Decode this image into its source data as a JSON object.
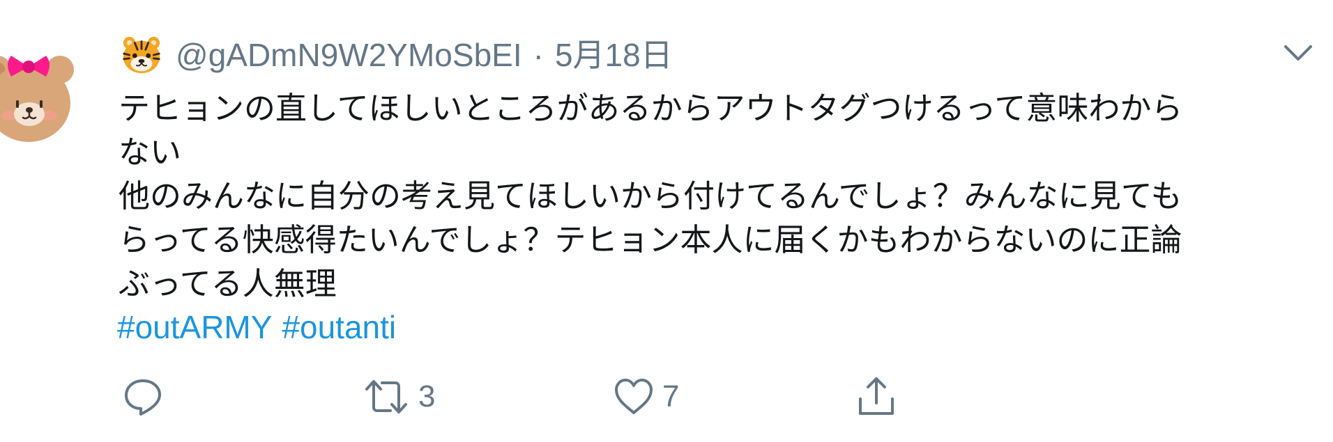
{
  "tweet": {
    "avatar_icon": "bear-with-pink-bow-avatar",
    "name_emoji_icon": "tiger-face-icon",
    "handle": "@gADmN9W2YMoSbEI",
    "separator": "·",
    "date": "5月18日",
    "menu_icon": "chevron-down-icon",
    "body_lines": [
      "テヒョンの直してほしいところがあるからアウトタグつけるって意味わから",
      "ない",
      "他のみんなに自分の考え見てほしいから付けてるんでしょ？みんなに見ても",
      "らってる快感得たいんでしょ？テヒョン本人に届くかもわからないのに正論",
      "ぶってる人無理"
    ],
    "hashtags": [
      "#outARMY",
      "#outanti"
    ],
    "actions": {
      "reply": {
        "icon": "reply-icon",
        "count": ""
      },
      "retweet": {
        "icon": "retweet-icon",
        "count": "3"
      },
      "like": {
        "icon": "heart-icon",
        "count": "7"
      },
      "share": {
        "icon": "share-icon",
        "count": ""
      }
    }
  },
  "colors": {
    "text": "#14171a",
    "secondary": "#657786",
    "link": "#1b95e0",
    "bow": "#ff1a8c",
    "bear": "#d9a67a"
  }
}
